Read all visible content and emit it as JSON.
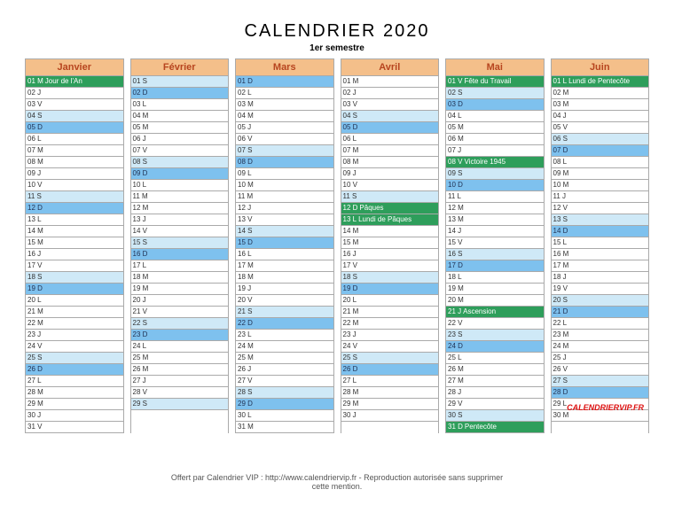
{
  "title": "CALENDRIER 2020",
  "subtitle": "1er semestre",
  "brand": "CALENDRIERVIP.FR",
  "footer": "Offert par Calendrier VIP : http://www.calendriervip.fr - Reproduction autorisée sans supprimer cette mention.",
  "dow": [
    "D",
    "L",
    "M",
    "M",
    "J",
    "V",
    "S"
  ],
  "holidays": {
    "1-1": "Jour de l'An",
    "4-12": "Pâques",
    "4-13": "Lundi de Pâques",
    "5-1": "Fête du Travail",
    "5-8": "Victoire 1945",
    "5-21": "Ascension",
    "5-31": "Pentecôte",
    "6-1": "Lundi de Pentecôte"
  },
  "months": [
    {
      "name": "Janvier",
      "days": 31,
      "start": 3
    },
    {
      "name": "Février",
      "days": 29,
      "start": 6
    },
    {
      "name": "Mars",
      "days": 31,
      "start": 0
    },
    {
      "name": "Avril",
      "days": 30,
      "start": 3
    },
    {
      "name": "Mai",
      "days": 31,
      "start": 5
    },
    {
      "name": "Juin",
      "days": 30,
      "start": 1
    }
  ]
}
